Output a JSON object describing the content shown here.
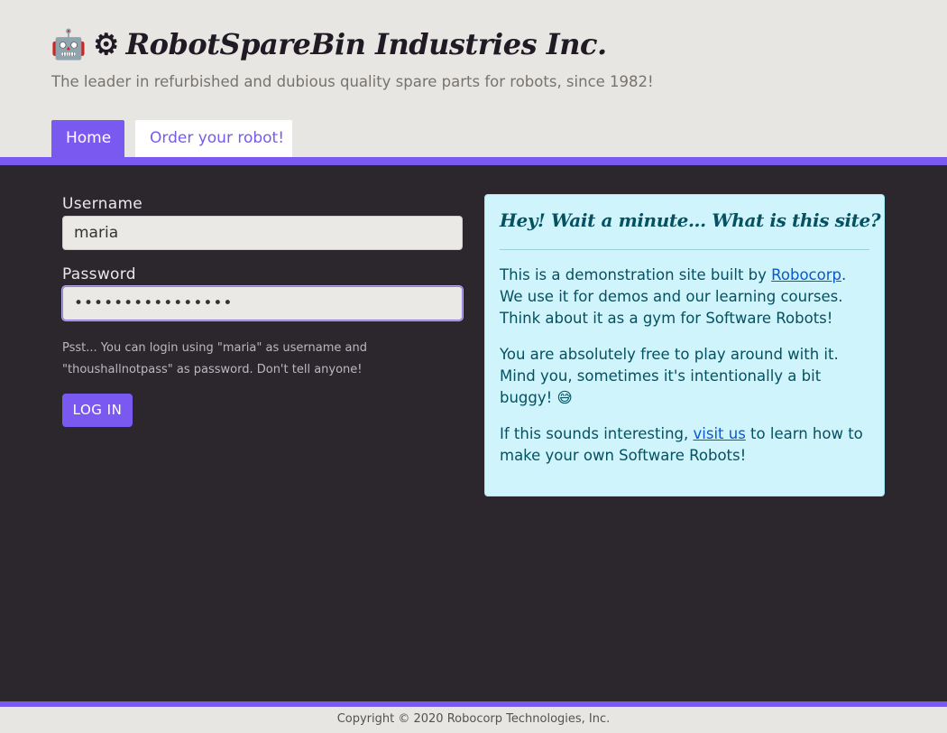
{
  "header": {
    "logo_icon": "🤖",
    "gear_icon": "⚙",
    "title": "RobotSpareBin Industries Inc.",
    "tagline": "The leader in refurbished and dubious quality spare parts for robots, since 1982!"
  },
  "nav": {
    "tabs": [
      {
        "label": "Home",
        "active": true
      },
      {
        "label": "Order your robot!",
        "active": false
      }
    ]
  },
  "login": {
    "username_label": "Username",
    "username_value": "maria",
    "password_label": "Password",
    "password_value": "••••••••••••••••",
    "hint": "Psst... You can login using \"maria\" as username and \"thoushallnotpass\" as password. Don't tell anyone!",
    "button_label": "LOG IN"
  },
  "info": {
    "title": "Hey! Wait a minute... What is this site?",
    "p1_prefix": "This is a demonstration site built by ",
    "p1_link": "Robocorp",
    "p1_suffix": ". We use it for demos and our learning courses. Think about it as a gym for Software Robots!",
    "p2": "You are absolutely free to play around with it. Mind you, sometimes it's intentionally a bit buggy! 😅",
    "p3_prefix": "If this sounds interesting, ",
    "p3_link": "visit us",
    "p3_suffix": " to learn how to make your own Software Robots!"
  },
  "footer": {
    "copyright": "Copyright © 2020 Robocorp Technologies, Inc."
  },
  "colors": {
    "accent": "#7a59f1",
    "background": "#2c272c",
    "header_bg": "#e8e6e3",
    "info_bg": "#cff4fc",
    "info_text": "#055160"
  }
}
